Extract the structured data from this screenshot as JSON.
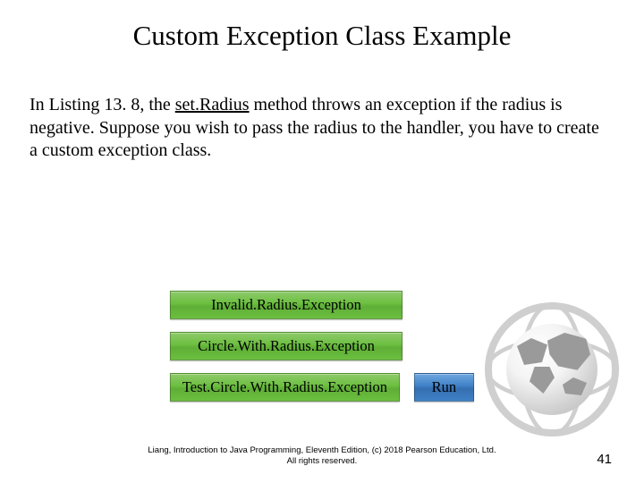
{
  "title": "Custom Exception Class Example",
  "body": {
    "pre": "In Listing 13. 8, the ",
    "underlined": "set.Radius",
    "post": " method throws an exception if the radius is negative. Suppose you wish to pass the radius to the handler, you have to create a custom exception class."
  },
  "buttons": {
    "b1": "Invalid.Radius.Exception",
    "b2": "Circle.With.Radius.Exception",
    "b3": "Test.Circle.With.Radius.Exception",
    "run": "Run"
  },
  "footer": {
    "line1": "Liang, Introduction to Java Programming, Eleventh Edition, (c) 2018 Pearson Education, Ltd.",
    "line2": "All rights reserved."
  },
  "page": "41"
}
